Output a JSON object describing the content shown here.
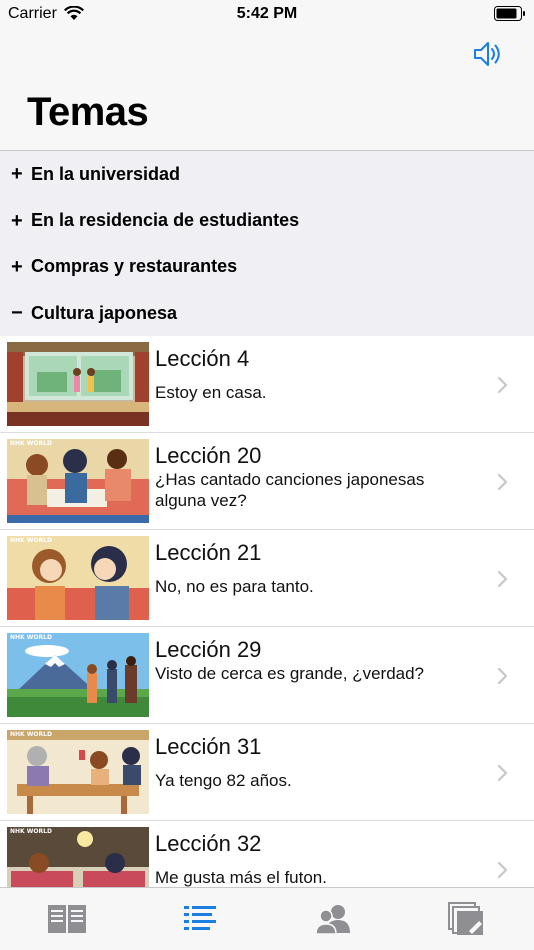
{
  "status": {
    "carrier": "Carrier",
    "time": "5:42 PM"
  },
  "header": {
    "title": "Temas"
  },
  "categories": [
    {
      "sign": "+",
      "label": "En la universidad"
    },
    {
      "sign": "+",
      "label": "En la residencia de estudiantes"
    },
    {
      "sign": "+",
      "label": "Compras y restaurantes"
    },
    {
      "sign": "−",
      "label": "Cultura japonesa"
    }
  ],
  "lessons": [
    {
      "title": "Lección 4",
      "subtitle": "Estoy en casa.",
      "tag": ""
    },
    {
      "title": "Lección 20",
      "subtitle": "¿Has cantado canciones japonesas alguna vez?",
      "tag": "NHK WORLD"
    },
    {
      "title": "Lección 21",
      "subtitle": "No, no es para tanto.",
      "tag": "NHK WORLD"
    },
    {
      "title": "Lección 29",
      "subtitle": "Visto de cerca es grande, ¿verdad?",
      "tag": "NHK WORLD"
    },
    {
      "title": "Lección 31",
      "subtitle": "Ya tengo 82 años.",
      "tag": "NHK WORLD"
    },
    {
      "title": "Lección 32",
      "subtitle": "Me gusta más el futon.",
      "tag": "NHK WORLD"
    }
  ],
  "colors": {
    "accent": "#1a7fe0",
    "tab_inactive": "#8e8e93"
  },
  "tabs": [
    {
      "icon": "book-icon",
      "active": false
    },
    {
      "icon": "list-icon",
      "active": true
    },
    {
      "icon": "people-icon",
      "active": false
    },
    {
      "icon": "notes-icon",
      "active": false
    }
  ]
}
